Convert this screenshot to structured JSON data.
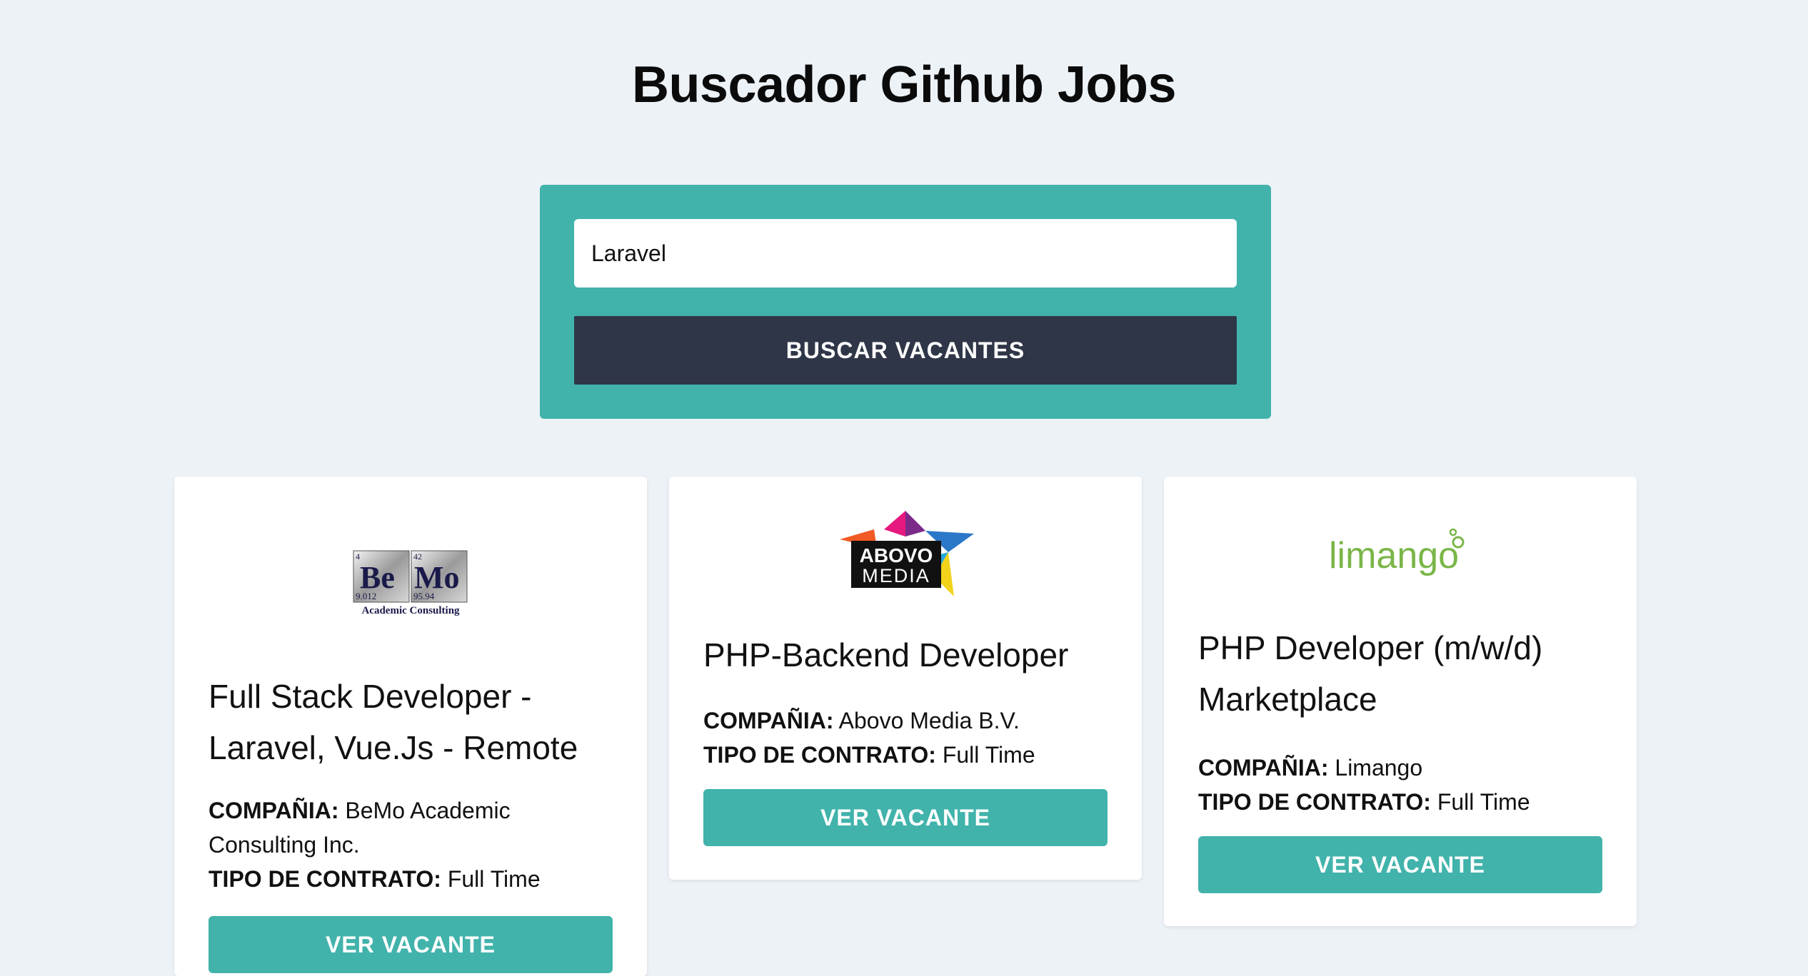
{
  "header": {
    "title": "Buscador Github Jobs"
  },
  "search": {
    "value": "Laravel",
    "button_label": "BUSCAR VACANTES"
  },
  "labels": {
    "company": "COMPAÑIA:",
    "contract": "TIPO DE CONTRATO:"
  },
  "jobs": [
    {
      "logo_text": {
        "left_num": "4",
        "left_sym": "Be",
        "left_mass": "9.012",
        "right_num": "42",
        "right_sym": "Mo",
        "right_mass": "95.94",
        "caption": "Academic Consulting"
      },
      "title": "Full Stack Developer - Laravel, Vue.Js - Remote",
      "company": "BeMo Academic Consulting Inc.",
      "contract": "Full Time",
      "button_label": "VER VACANTE"
    },
    {
      "logo_text": {
        "line1": "ABOVO",
        "line2": "MEDIA"
      },
      "title": "PHP-Backend Developer",
      "company": "Abovo Media B.V.",
      "contract": "Full Time",
      "button_label": "VER VACANTE"
    },
    {
      "logo_text": {
        "word": "limango"
      },
      "title": "PHP Developer (m/w/d) Marketplace",
      "company": "Limango",
      "contract": "Full Time",
      "button_label": "VER VACANTE"
    }
  ],
  "colors": {
    "background": "#edf2f7",
    "accent": "#41b3ab",
    "dark_button": "#2f3648",
    "limango_green": "#7ab648"
  }
}
